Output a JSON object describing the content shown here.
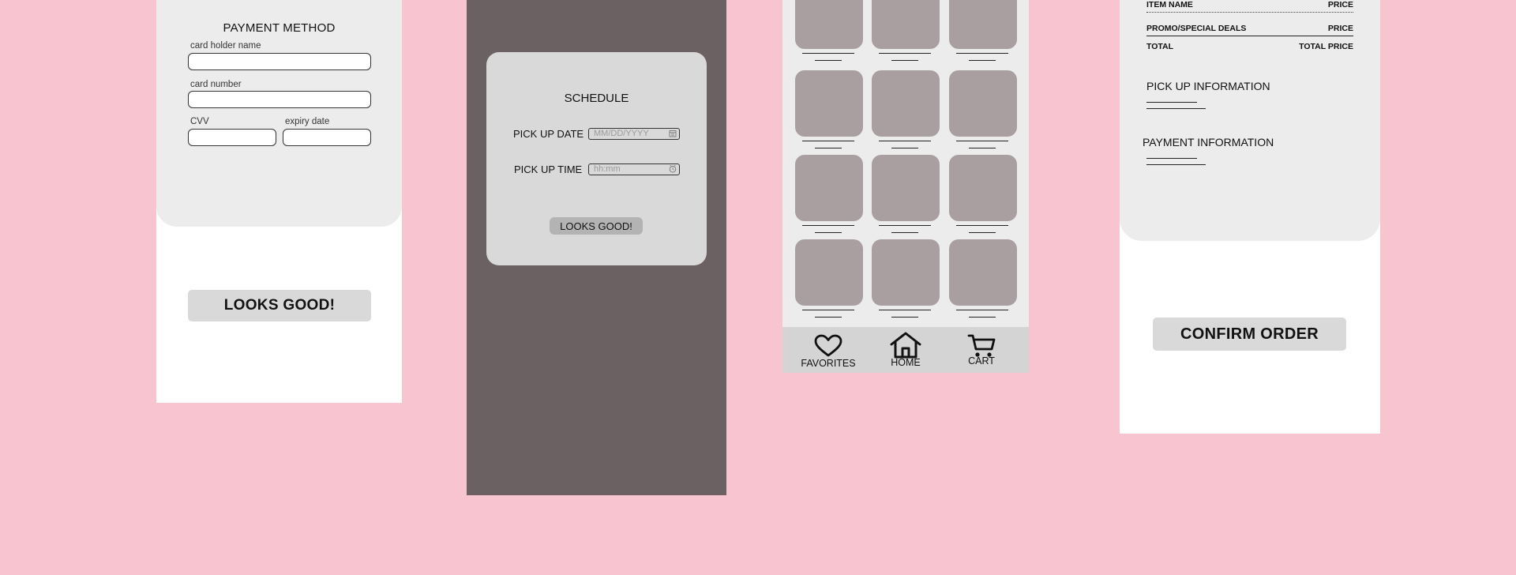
{
  "colors": {
    "background": "#f8c4d0",
    "panel": "#ececec",
    "overlay": "#6b6162",
    "modal": "#d9d9d9",
    "tile": "#a99fa0",
    "nav": "#d4d4d4",
    "button": "#d9d9d9"
  },
  "payment": {
    "title": "PAYMENT METHOD",
    "card_holder_label": "card holder name",
    "card_number_label": "card number",
    "cvv_label": "CVV",
    "expiry_label": "expiry date",
    "submit_label": "LOOKS GOOD!"
  },
  "schedule": {
    "title": "SCHEDULE",
    "date_label": "PICK UP DATE",
    "date_placeholder": "MM/DD/YYYY",
    "time_label": "PICK UP TIME",
    "time_placeholder": "hh:mm",
    "submit_label": "LOOKS GOOD!"
  },
  "grid": {
    "nav": [
      {
        "label": "FAVORITES",
        "icon": "heart-icon"
      },
      {
        "label": "HOME",
        "icon": "home-icon"
      },
      {
        "label": "CART",
        "icon": "cart-icon"
      }
    ]
  },
  "summary": {
    "item_label": "ITEM NAME",
    "item_value": "PRICE",
    "promo_label": "PROMO/SPECIAL DEALS",
    "promo_value": "PRICE",
    "total_label": "TOTAL",
    "total_value": "TOTAL PRICE",
    "pickup_heading": "PICK UP INFORMATION",
    "payment_heading": "PAYMENT INFORMATION",
    "confirm_label": "CONFIRM ORDER"
  }
}
